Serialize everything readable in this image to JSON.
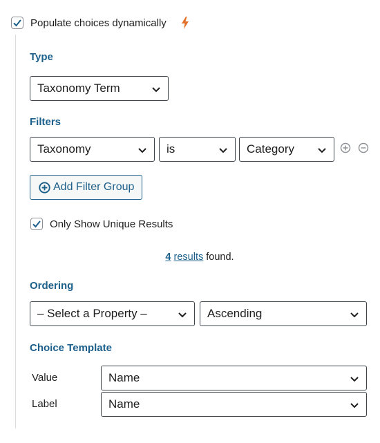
{
  "populate": {
    "label": "Populate choices dynamically",
    "checked": true,
    "icon": "bolt-icon",
    "accent": "#e26f2a"
  },
  "type": {
    "heading": "Type",
    "value": "Taxonomy Term"
  },
  "filters": {
    "heading": "Filters",
    "field": "Taxonomy",
    "operator": "is",
    "value": "Category",
    "add_group_label": "Add Filter Group"
  },
  "unique": {
    "label": "Only Show Unique Results",
    "checked": true
  },
  "results": {
    "count": "4",
    "link_word": "results",
    "suffix": "found."
  },
  "ordering": {
    "heading": "Ordering",
    "property": "– Select a Property –",
    "direction": "Ascending"
  },
  "choice_template": {
    "heading": "Choice Template",
    "value_label": "Value",
    "value_select": "Name",
    "label_label": "Label",
    "label_select": "Name"
  },
  "colors": {
    "heading": "#1b5f8a",
    "border": "#3c434a",
    "rail": "#dcdcde"
  }
}
